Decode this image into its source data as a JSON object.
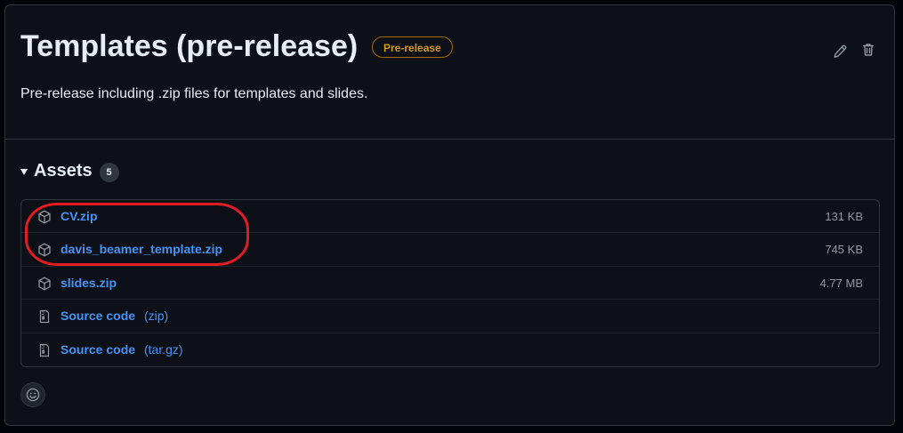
{
  "release": {
    "title": "Templates (pre-release)",
    "badge": "Pre-release",
    "description": "Pre-release including .zip files for templates and slides."
  },
  "assets": {
    "label": "Assets",
    "count": "5",
    "items": [
      {
        "name": "CV.zip",
        "size": "131 KB",
        "icon": "package-icon"
      },
      {
        "name": "davis_beamer_template.zip",
        "size": "745 KB",
        "icon": "package-icon"
      },
      {
        "name": "slides.zip",
        "size": "4.77 MB",
        "icon": "package-icon"
      },
      {
        "name": "Source code",
        "suffix": "(zip)",
        "icon": "file-zip-icon"
      },
      {
        "name": "Source code",
        "suffix": "(tar.gz)",
        "icon": "file-zip-icon"
      }
    ]
  },
  "colors": {
    "background": "#0d1117",
    "border": "#30363d",
    "link": "#4493f8",
    "prerelease": "#d29922",
    "annotation": "#e31b23"
  },
  "icons": {
    "edit": "pencil-icon",
    "delete": "trash-icon",
    "reaction": "smiley-icon"
  }
}
